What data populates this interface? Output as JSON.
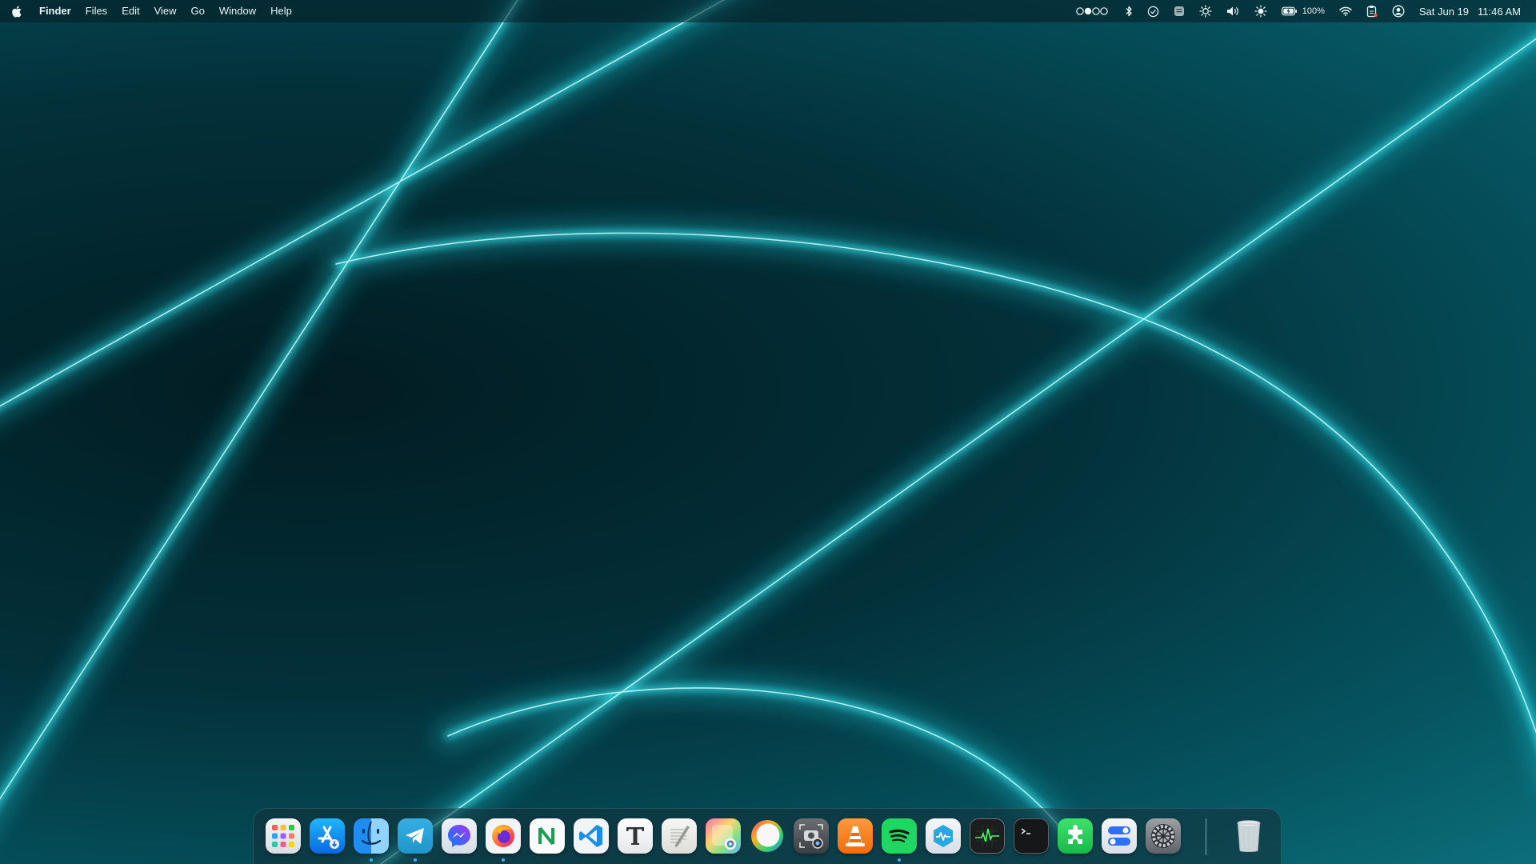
{
  "menubar": {
    "app_name": "Finder",
    "menus": [
      "Files",
      "Edit",
      "View",
      "Go",
      "Window",
      "Help"
    ],
    "status": {
      "battery_percent": "100%",
      "date": "Sat Jun 19",
      "time": "11:46 AM"
    }
  },
  "dock": {
    "apps": [
      {
        "icon": "launchpad-icon",
        "running": false
      },
      {
        "icon": "app-store-icon",
        "running": false
      },
      {
        "icon": "finder-icon",
        "running": true
      },
      {
        "icon": "telegram-icon",
        "running": true
      },
      {
        "icon": "messenger-icon",
        "running": false
      },
      {
        "icon": "firefox-icon",
        "running": true
      },
      {
        "icon": "notion-icon",
        "running": false
      },
      {
        "icon": "vscode-icon",
        "running": false
      },
      {
        "icon": "typora-icon",
        "running": false
      },
      {
        "icon": "textedit-icon",
        "running": false
      },
      {
        "icon": "photos-icon",
        "running": false
      },
      {
        "icon": "pock-icon",
        "running": false
      },
      {
        "icon": "screenshot-icon",
        "running": false
      },
      {
        "icon": "vlc-icon",
        "running": false
      },
      {
        "icon": "spotify-icon",
        "running": true
      },
      {
        "icon": "stats-icon",
        "running": false
      },
      {
        "icon": "activity-monitor-icon",
        "running": false
      },
      {
        "icon": "terminal-icon",
        "running": false
      },
      {
        "icon": "plugin-icon",
        "running": false
      },
      {
        "icon": "toggles-icon",
        "running": false
      },
      {
        "icon": "system-preferences-icon",
        "running": false
      },
      {
        "icon": "trash-icon",
        "running": false
      }
    ]
  },
  "colors": {
    "wallpaper_glow": "#27e3ef",
    "wallpaper_dark": "#03313a",
    "running_indicator": "#4aa8ff"
  }
}
